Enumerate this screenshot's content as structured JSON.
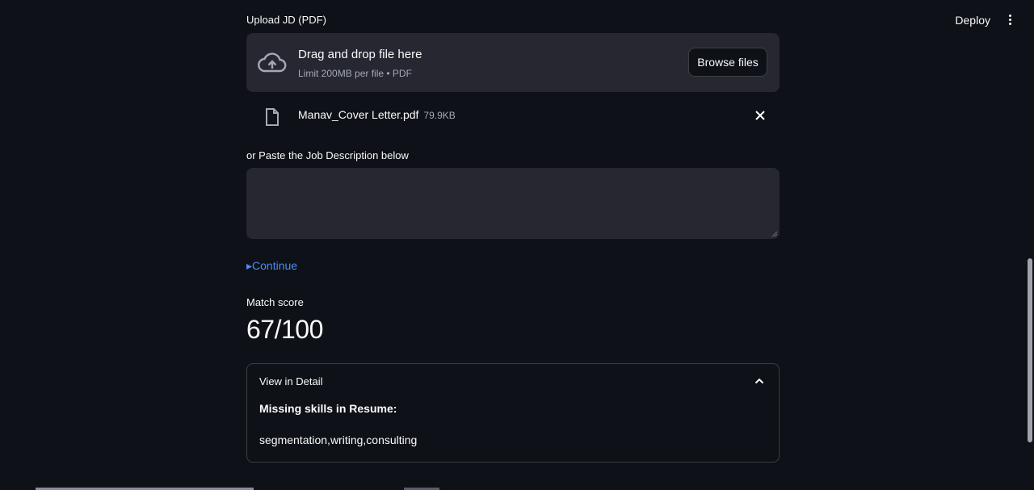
{
  "header": {
    "deploy_label": "Deploy"
  },
  "uploader": {
    "label": "Upload JD (PDF)",
    "drop_title": "Drag and drop file here",
    "drop_subtitle": "Limit 200MB per file • PDF",
    "browse_label": "Browse files"
  },
  "uploaded_file": {
    "name": "Manav_Cover Letter.pdf",
    "size": "79.9KB"
  },
  "job_description": {
    "label": "or Paste the Job Description below",
    "value": ""
  },
  "continue_label": "▸Continue",
  "match": {
    "label": "Match score",
    "value": "67/100"
  },
  "expander": {
    "title": "View in Detail",
    "heading": "Missing skills in Resume:",
    "skills": "segmentation,writing,consulting"
  },
  "colors": {
    "background": "#0e1117",
    "surface": "#262730",
    "link": "#4a8cf5",
    "text": "#fafafa"
  }
}
